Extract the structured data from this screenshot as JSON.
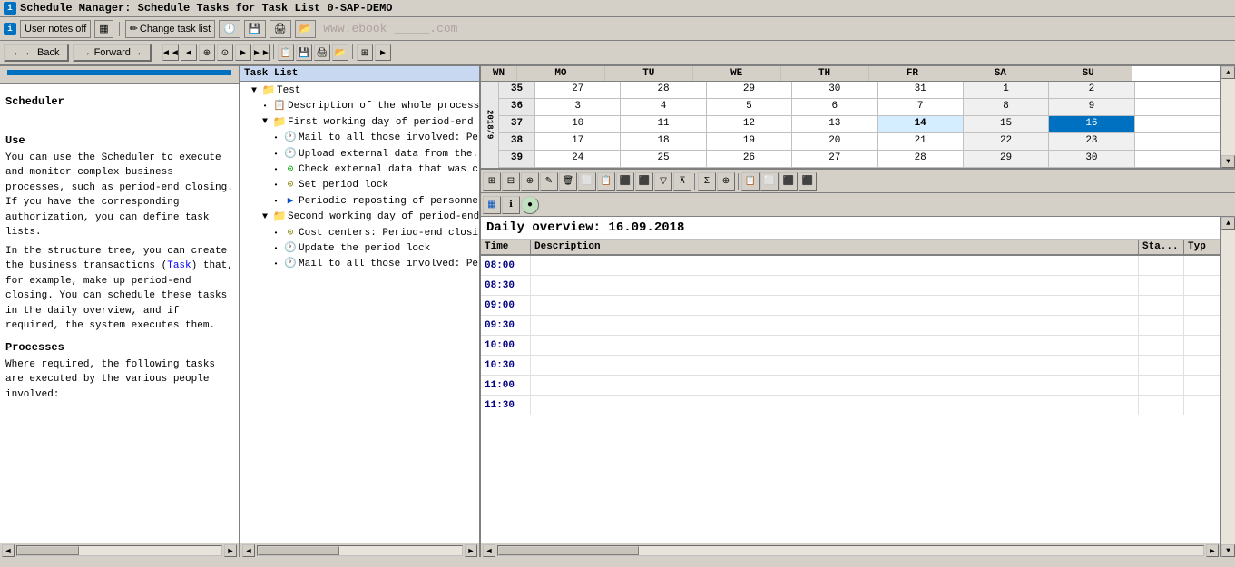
{
  "window": {
    "title": "Schedule Manager: Schedule Tasks for Task List 0-SAP-DEMO"
  },
  "menubar": {
    "user_notes": "User notes off",
    "change_task_list": "Change task list"
  },
  "nav": {
    "back_label": "← Back",
    "forward_label": "→ Forward"
  },
  "left_panel": {
    "progress_color": "#0070c0",
    "heading1": "Scheduler",
    "use_title": "Use",
    "use_text1": "You can use the Scheduler to execute and monitor complex business processes, such as period-end closing. If you have the corresponding authorization, you can define task lists.",
    "use_text2": "In the structure tree, you can create the business transactions (Task) that, for example, make up period-end closing. You can schedule these tasks in the daily overview, and if required, the system executes them.",
    "processes_title": "Processes",
    "processes_text": "Where required, the following tasks are executed by the various people involved:",
    "task_link": "Task"
  },
  "task_list": {
    "label": "Task List",
    "items": [
      {
        "id": "test",
        "level": 1,
        "type": "folder",
        "label": "Test",
        "expanded": true
      },
      {
        "id": "desc",
        "level": 2,
        "type": "task",
        "label": "Description of the whole process"
      },
      {
        "id": "first_working",
        "level": 2,
        "type": "folder",
        "label": "First working day of period-end clo...",
        "expanded": true
      },
      {
        "id": "mail1",
        "level": 3,
        "type": "task_clock",
        "label": "Mail to all those involved: Perio..."
      },
      {
        "id": "upload",
        "level": 3,
        "type": "task_clock",
        "label": "Upload external data from the..."
      },
      {
        "id": "check",
        "level": 3,
        "type": "task_check",
        "label": "Check external data that was c..."
      },
      {
        "id": "set_lock",
        "level": 3,
        "type": "task_clock",
        "label": "Set period lock"
      },
      {
        "id": "periodic",
        "level": 3,
        "type": "task_blue",
        "label": "Periodic reposting of personne..."
      },
      {
        "id": "second_working",
        "level": 2,
        "type": "folder",
        "label": "Second working day of period-end...",
        "expanded": true
      },
      {
        "id": "cost_centers",
        "level": 3,
        "type": "task_clock",
        "label": "Cost centers: Period-end closin..."
      },
      {
        "id": "update_lock",
        "level": 3,
        "type": "task_clock",
        "label": "Update the period lock"
      },
      {
        "id": "mail2",
        "level": 3,
        "type": "task_clock",
        "label": "Mail to all those involved: Perio..."
      }
    ]
  },
  "calendar": {
    "year_label": "2018/9",
    "headers": [
      "WN",
      "MO",
      "TU",
      "WE",
      "TH",
      "FR",
      "SA",
      "SU"
    ],
    "rows": [
      {
        "wn": "35",
        "mo": "27",
        "tu": "28",
        "we": "29",
        "th": "30",
        "fr": "31",
        "sa": "1",
        "su": "2"
      },
      {
        "wn": "36",
        "mo": "3",
        "tu": "4",
        "we": "5",
        "th": "6",
        "fr": "7",
        "sa": "8",
        "su": "9"
      },
      {
        "wn": "37",
        "mo": "10",
        "tu": "11",
        "we": "12",
        "th": "13",
        "fr": "14",
        "sa": "15",
        "su": "16",
        "selected_col": 8
      },
      {
        "wn": "38",
        "mo": "17",
        "tu": "18",
        "we": "19",
        "th": "20",
        "fr": "21",
        "sa": "22",
        "su": "23"
      },
      {
        "wn": "39",
        "mo": "24",
        "tu": "25",
        "we": "26",
        "th": "27",
        "fr": "28",
        "sa": "29",
        "su": "30"
      }
    ]
  },
  "daily_overview": {
    "title": "Daily overview: 16.09.2018",
    "columns": [
      "Time",
      "Description",
      "Sta...",
      "Typ"
    ],
    "time_slots": [
      "08:00",
      "08:30",
      "09:00",
      "09:30",
      "10:00",
      "10:30",
      "11:00",
      "11:30"
    ]
  },
  "icons": {
    "info": "i",
    "arrow_left": "◄",
    "arrow_right": "►",
    "arrow_up": "▲",
    "arrow_down": "▼",
    "folder": "📁",
    "task": "📋",
    "clock": "🕐",
    "check": "✓",
    "expand": "▼",
    "collapse": "►",
    "expand_tree": "+",
    "minus": "-"
  }
}
